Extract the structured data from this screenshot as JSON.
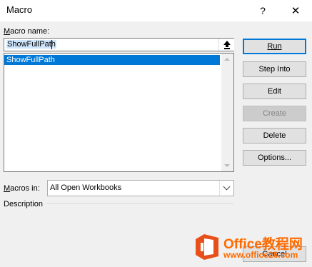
{
  "window": {
    "title": "Macro",
    "help_glyph": "?",
    "close_glyph": "✕"
  },
  "macro_name": {
    "label": "Macro name:",
    "value": "ShowFullPath",
    "picker_icon": "up-arrow-bar-icon"
  },
  "macro_list": {
    "items": [
      "ShowFullPath"
    ],
    "selected_index": 0
  },
  "macros_in": {
    "label": "Macros in:",
    "value": "All Open Workbooks"
  },
  "description": {
    "label": "Description"
  },
  "buttons": {
    "run": "Run",
    "step_into": "Step Into",
    "edit": "Edit",
    "create": "Create",
    "delete": "Delete",
    "options": "Options...",
    "cancel": "Cancel"
  },
  "watermark": {
    "title": "Office教程网",
    "url": "www.office26.com"
  },
  "colors": {
    "accent": "#0078d7",
    "watermark": "#ff6a00"
  }
}
